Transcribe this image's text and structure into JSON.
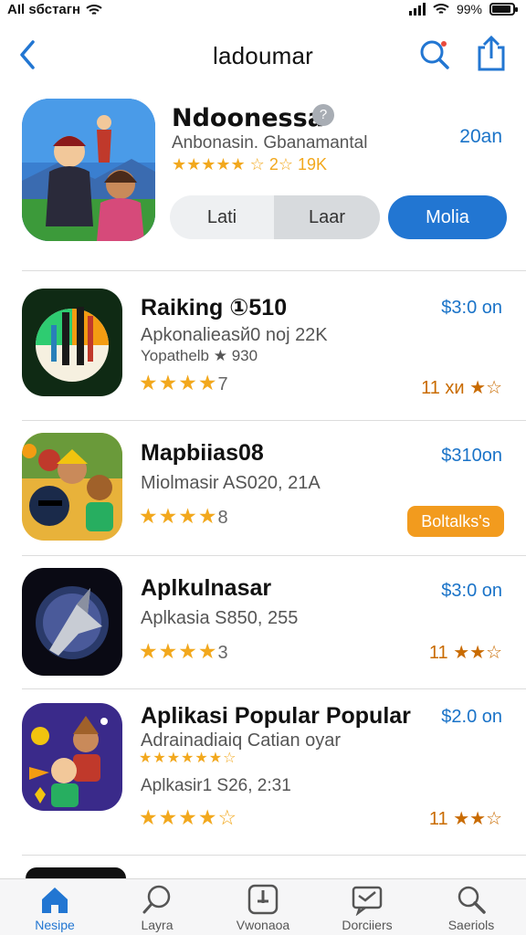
{
  "status_bar": {
    "carrier": "АIl ѕбстагн",
    "battery": "99%"
  },
  "nav": {
    "title": "ladoumar",
    "back_icon": "chevron-left-icon",
    "search_icon": "search-icon",
    "share_icon": "share-icon"
  },
  "featured": {
    "name": "Ndoonessa",
    "subtitle": "Anbonasin. Gbanamantal",
    "rating": "★★★★★ ☆ 2☆ 19K",
    "price": "20an",
    "seg_left": "Lati",
    "seg_right": "Laar",
    "primary_button": "Molia"
  },
  "apps": [
    {
      "name": "Raiking ①510",
      "line1": "Apkonalieasй0 noj 22K",
      "line2": "Yopathelb ★ 930",
      "stars": "★★★★",
      "rating_num": "7",
      "price": "$3:0 on",
      "right_tag": "11 хи ★☆"
    },
    {
      "name": "Mapbiias08",
      "line1": "Miolmasir AS020, 21A",
      "line2": "",
      "stars": "★★★★",
      "rating_num": "8",
      "price": "$310on",
      "button": "Boltalks's"
    },
    {
      "name": "Aplkulnasar",
      "line1": "Aplkasia S850, 255",
      "line2": "",
      "stars": "★★★★",
      "rating_num": "3",
      "price": "$3:0 on",
      "right_tag": "11 ★★☆"
    },
    {
      "name": "Aplikasi Popular Popular",
      "line1": "Adrainadiaiq Catian oyar",
      "line1b": "★★★★★★☆",
      "line2": "Aplkasir1 S26, 2:31",
      "stars": "★★★★☆",
      "rating_num": "",
      "price": "$2.0 on",
      "right_tag": "11 ★★☆"
    }
  ],
  "tabs": [
    {
      "label": "Nesipe",
      "icon": "home-icon",
      "active": true
    },
    {
      "label": "Layra",
      "icon": "search-bubble-icon",
      "active": false
    },
    {
      "label": "Vwonaoa",
      "icon": "plus-box-icon",
      "active": false
    },
    {
      "label": "Dorciiers",
      "icon": "message-icon",
      "active": false
    },
    {
      "label": "Saeriols",
      "icon": "search-icon",
      "active": false
    }
  ],
  "colors": {
    "accent": "#2276d2",
    "star": "#f2a81d",
    "orange": "#f29b1e"
  }
}
